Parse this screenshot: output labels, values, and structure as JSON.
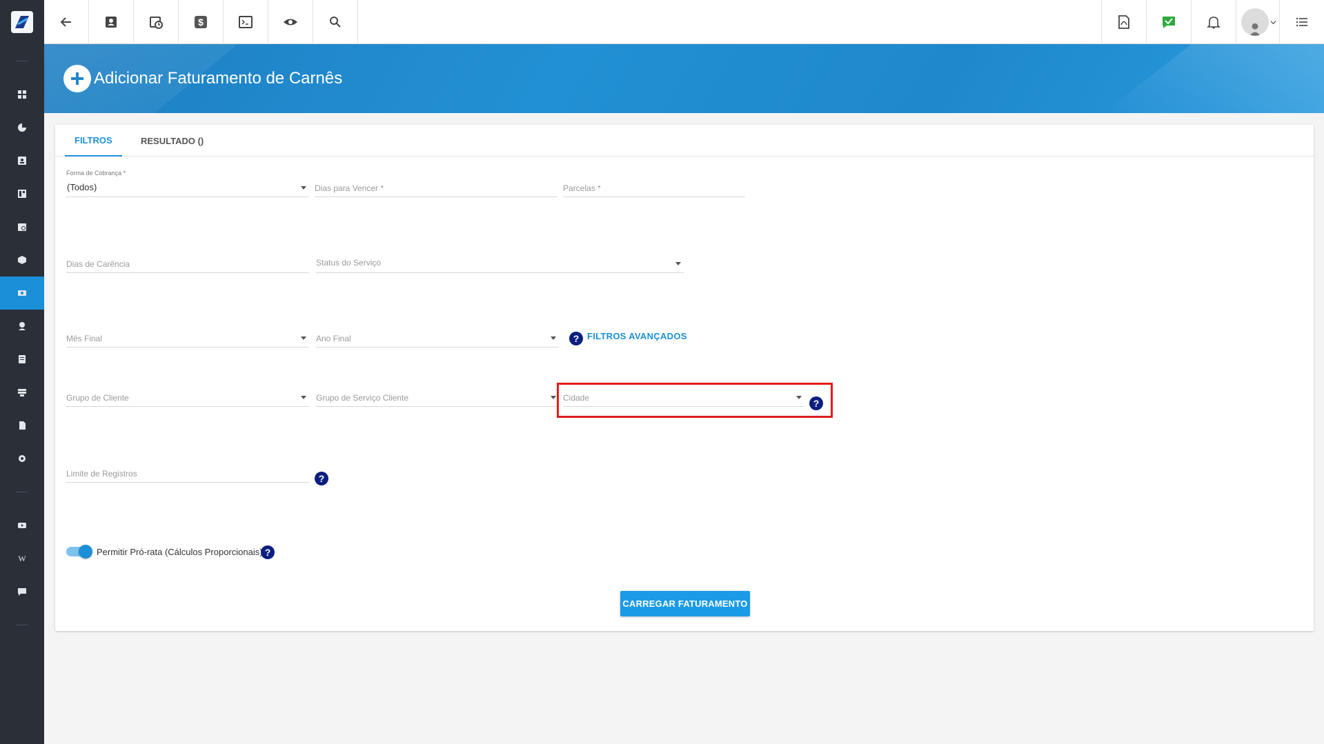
{
  "header": {
    "title": "Adicionar Faturamento de Carnês",
    "toolbar_icons": [
      "back-arrow-icon",
      "contact-card-icon",
      "calendar-clock-icon",
      "dollar-icon",
      "terminal-icon",
      "eye-icon",
      "search-icon"
    ],
    "right_icons": [
      "pdf-icon",
      "chat-check-icon",
      "bell-icon",
      "avatar",
      "list-menu-icon"
    ]
  },
  "sidebar": {
    "items": [
      "dashboard-icon",
      "pie-chart-icon",
      "contacts-icon",
      "layout-icon",
      "calendar-icon",
      "package-icon",
      "billing-icon",
      "map-pin-icon",
      "list-icon",
      "server-icon",
      "document-icon",
      "settings-icon",
      "video-icon",
      "wiki-icon",
      "chat-icon"
    ],
    "active_index": 6,
    "wiki_letter": "W"
  },
  "tabs": [
    {
      "label": "FILTROS",
      "active": true
    },
    {
      "label": "RESULTADO ()",
      "active": false
    }
  ],
  "form": {
    "forma_cobranca": {
      "label": "Forma de Cobrança *",
      "value": "(Todos)"
    },
    "dias_vencer": {
      "placeholder": "Dias para Vencer *"
    },
    "parcelas": {
      "placeholder": "Parcelas *"
    },
    "dias_carencia": {
      "placeholder": "Dias de Carência"
    },
    "status_servico": {
      "placeholder": "Status do Serviço"
    },
    "mes_final": {
      "placeholder": "Mês Final"
    },
    "ano_final": {
      "placeholder": "Ano Final"
    },
    "filtros_avancados": "FILTROS AVANÇADOS",
    "grupo_cliente": {
      "placeholder": "Grupo de Cliente"
    },
    "grupo_servico_cliente": {
      "placeholder": "Grupo de Serviço Cliente"
    },
    "cidade": {
      "placeholder": "Cidade"
    },
    "limite_registros": {
      "placeholder": "Limite de Registros"
    },
    "pro_rata": {
      "label": "Permitir Pró-rata (Cálculos Proporcionais)",
      "enabled": true
    },
    "help_glyph": "?"
  },
  "actions": {
    "carregar": "CARREGAR FATURAMENTO"
  },
  "colors": {
    "accent": "#1b8fd8",
    "sidebar": "#2b2f38",
    "highlight": "#e41c1c",
    "help": "#0b1f80"
  }
}
